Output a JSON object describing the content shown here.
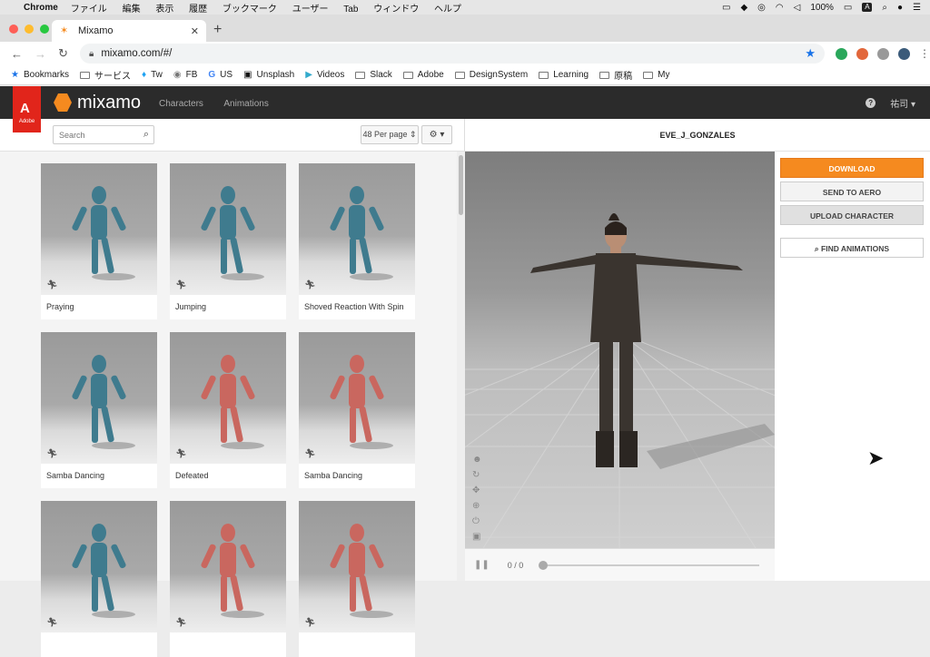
{
  "macbar": {
    "apple": "",
    "app": "Chrome",
    "menus": [
      "ファイル",
      "編集",
      "表示",
      "履歴",
      "ブックマーク",
      "ユーザー",
      "Tab",
      "ウィンドウ",
      "ヘルプ"
    ],
    "battery": "100%",
    "input": "A"
  },
  "browser": {
    "tab_title": "Mixamo",
    "url": "mixamo.com/#/"
  },
  "bookmarks": [
    "Bookmarks",
    "サービス",
    "Tw",
    "FB",
    "US",
    "Unsplash",
    "Videos",
    "Slack",
    "Adobe",
    "DesignSystem",
    "Learning",
    "原稿",
    "My"
  ],
  "header": {
    "adobe_label": "Adobe",
    "logo_text": "mixamo",
    "nav": [
      "Characters",
      "Animations"
    ],
    "user": "祐司"
  },
  "left": {
    "search_placeholder": "Search",
    "per_page": "48 Per page ⇕",
    "cards": [
      {
        "label": "Praying",
        "color": "#3f7b8e"
      },
      {
        "label": "Jumping",
        "color": "#3f7b8e"
      },
      {
        "label": "Shoved Reaction With Spin",
        "color": "#3f7b8e"
      },
      {
        "label": "Samba Dancing",
        "color": "#3f7b8e"
      },
      {
        "label": "Defeated",
        "color": "#c9675f"
      },
      {
        "label": "Samba Dancing",
        "color": "#c9675f"
      },
      {
        "label": "",
        "color": "#3f7b8e"
      },
      {
        "label": "",
        "color": "#c9675f"
      },
      {
        "label": "",
        "color": "#c9675f"
      }
    ]
  },
  "right": {
    "character_name": "EVE_J_GONZALES",
    "buttons": {
      "download": "DOWNLOAD",
      "send": "SEND TO AERO",
      "upload": "UPLOAD CHARACTER",
      "find": "FIND ANIMATIONS"
    },
    "frame_count": "0 / 0"
  }
}
